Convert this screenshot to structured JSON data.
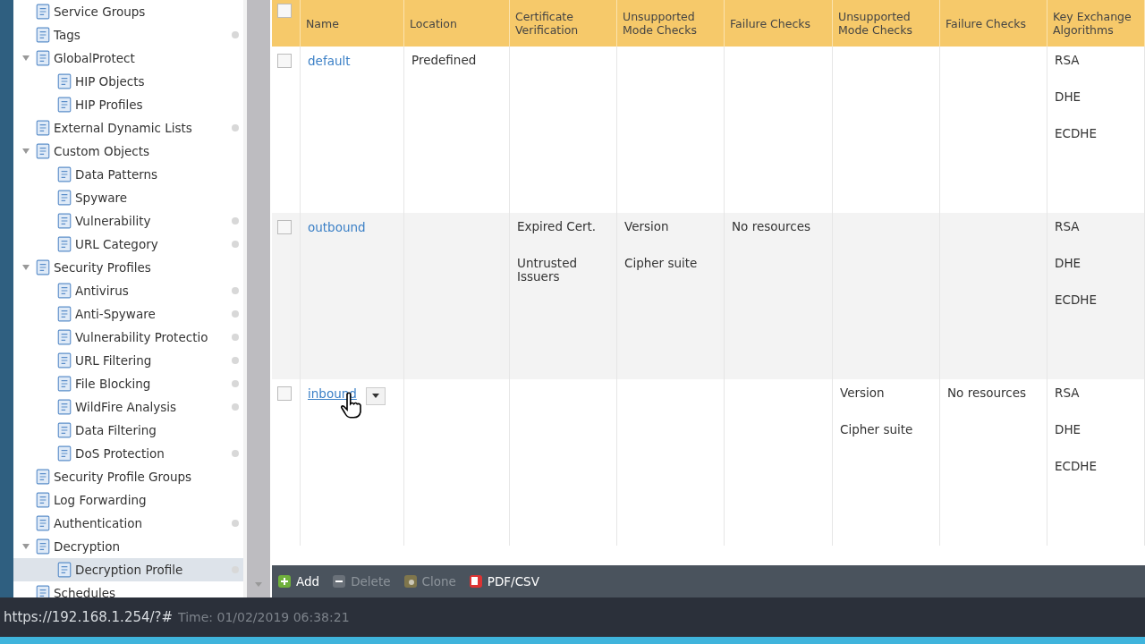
{
  "tree": [
    {
      "label": "Service Groups",
      "dot": false,
      "selected": false
    },
    {
      "label": "Tags",
      "dot": true,
      "selected": false
    },
    {
      "label": "GlobalProtect",
      "expanded": true,
      "dot": false,
      "selected": false,
      "children": [
        {
          "label": "HIP Objects",
          "dot": false,
          "selected": false
        },
        {
          "label": "HIP Profiles",
          "dot": false,
          "selected": false
        }
      ]
    },
    {
      "label": "External Dynamic Lists",
      "dot": true,
      "selected": false
    },
    {
      "label": "Custom Objects",
      "expanded": true,
      "dot": false,
      "selected": false,
      "children": [
        {
          "label": "Data Patterns",
          "dot": false,
          "selected": false
        },
        {
          "label": "Spyware",
          "dot": false,
          "selected": false
        },
        {
          "label": "Vulnerability",
          "dot": true,
          "selected": false
        },
        {
          "label": "URL Category",
          "dot": true,
          "selected": false
        }
      ]
    },
    {
      "label": "Security Profiles",
      "expanded": true,
      "dot": false,
      "selected": false,
      "children": [
        {
          "label": "Antivirus",
          "dot": true,
          "selected": false
        },
        {
          "label": "Anti-Spyware",
          "dot": true,
          "selected": false
        },
        {
          "label": "Vulnerability Protectio",
          "dot": true,
          "selected": false
        },
        {
          "label": "URL Filtering",
          "dot": true,
          "selected": false
        },
        {
          "label": "File Blocking",
          "dot": true,
          "selected": false
        },
        {
          "label": "WildFire Analysis",
          "dot": true,
          "selected": false
        },
        {
          "label": "Data Filtering",
          "dot": false,
          "selected": false
        },
        {
          "label": "DoS Protection",
          "dot": true,
          "selected": false
        }
      ]
    },
    {
      "label": "Security Profile Groups",
      "dot": false,
      "selected": false
    },
    {
      "label": "Log Forwarding",
      "dot": false,
      "selected": false
    },
    {
      "label": "Authentication",
      "dot": true,
      "selected": false
    },
    {
      "label": "Decryption",
      "expanded": true,
      "dot": false,
      "selected": false,
      "children": [
        {
          "label": "Decryption Profile",
          "dot": true,
          "selected": true
        }
      ]
    },
    {
      "label": "Schedules",
      "dot": false,
      "selected": false
    }
  ],
  "table": {
    "select_all": {
      "checked": false
    },
    "columns": [
      "Name",
      "Location",
      "Certificate Verification",
      "Unsupported Mode Checks",
      "Failure Checks",
      "Unsupported Mode Checks",
      "Failure Checks",
      "Key Exchange Algorithms"
    ],
    "rows": [
      {
        "checked": false,
        "menu": false,
        "cells": [
          [
            "default"
          ],
          [
            "Predefined"
          ],
          [],
          [],
          [],
          [],
          [],
          [
            "RSA",
            "DHE",
            "ECDHE"
          ]
        ]
      },
      {
        "checked": false,
        "menu": false,
        "cells": [
          [
            "outbound"
          ],
          [],
          [
            "Expired Cert.",
            "Untrusted Issuers"
          ],
          [
            "Version",
            "Cipher suite"
          ],
          [
            "No resources"
          ],
          [],
          [],
          [
            "RSA",
            "DHE",
            "ECDHE"
          ]
        ]
      },
      {
        "checked": false,
        "menu": true,
        "cells": [
          [
            "inbound"
          ],
          [],
          [],
          [],
          [],
          [
            "Version",
            "Cipher suite"
          ],
          [
            "No resources"
          ],
          [
            "RSA",
            "DHE",
            "ECDHE"
          ]
        ]
      }
    ]
  },
  "toolbar": [
    {
      "label": "Add",
      "kind": "add",
      "disabled": false
    },
    {
      "label": "Delete",
      "kind": "delete",
      "disabled": true
    },
    {
      "label": "Clone",
      "kind": "clone",
      "disabled": true
    },
    {
      "label": "PDF/CSV",
      "kind": "pdf",
      "disabled": false
    }
  ],
  "status_bar": {
    "url": "https://192.168.1.254/?#",
    "text": "Time: 01/02/2019 06:38:21"
  }
}
